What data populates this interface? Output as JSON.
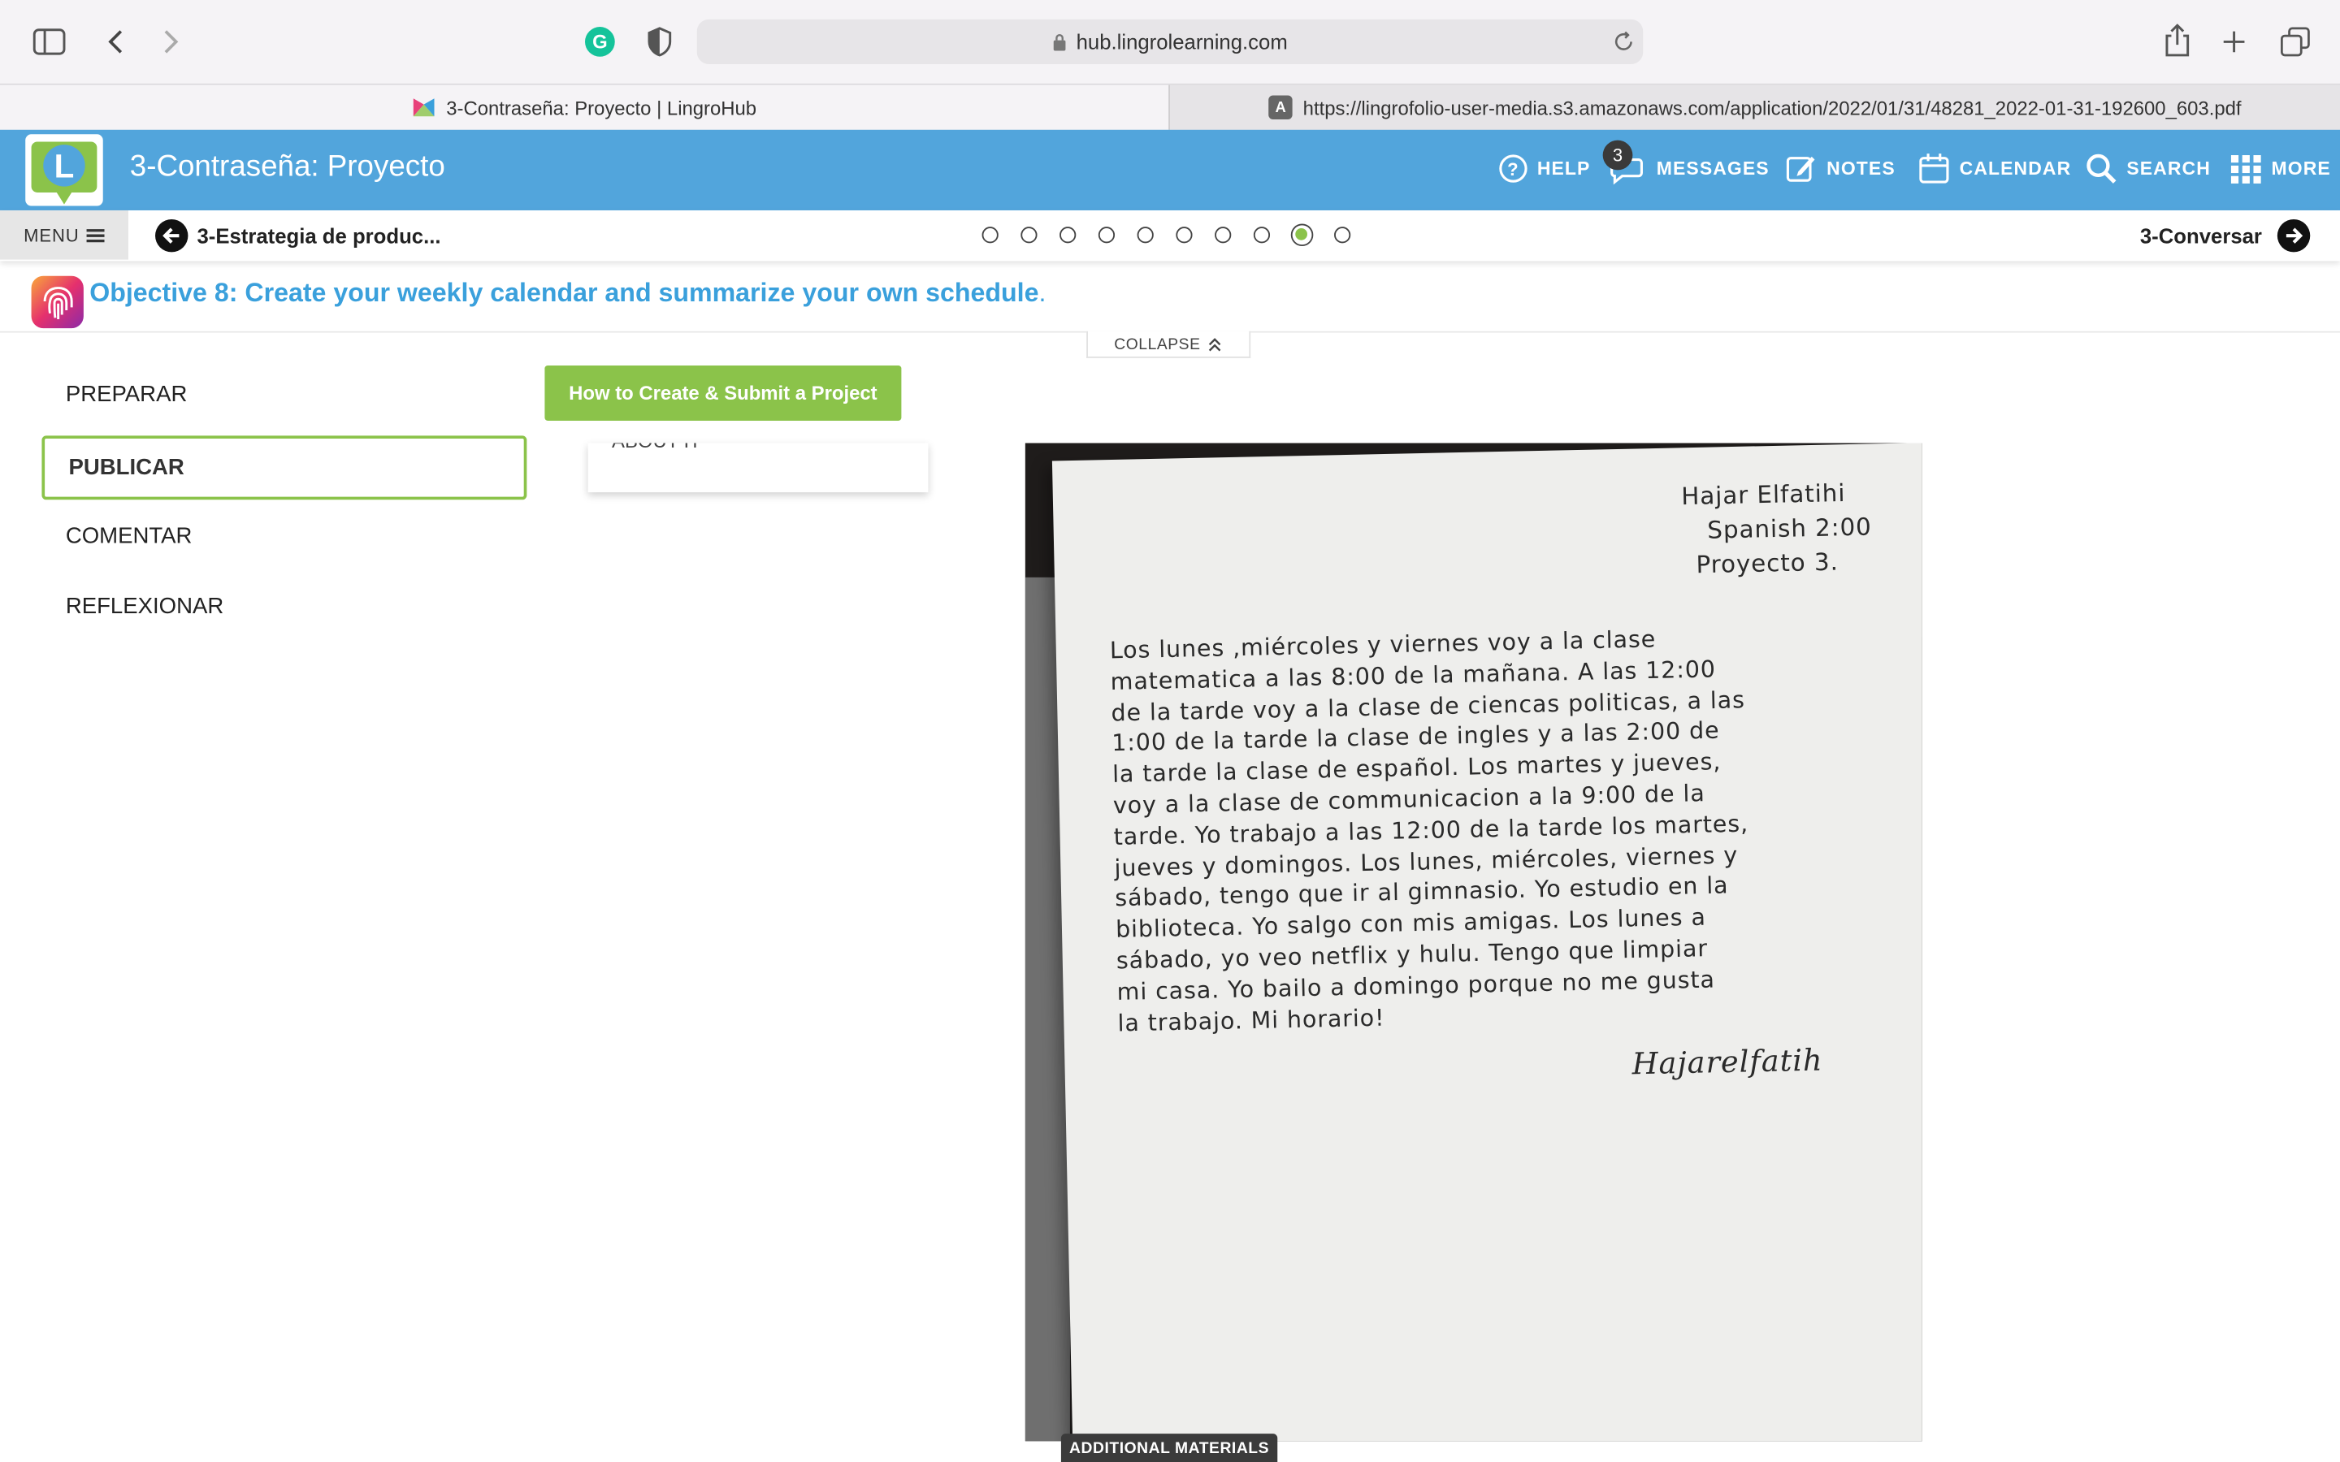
{
  "browser": {
    "url": "hub.lingrolearning.com",
    "tabs": [
      {
        "title": "3-Contraseña: Proyecto | LingroHub"
      },
      {
        "title": "https://lingrofolio-user-media.s3.amazonaws.com/application/2022/01/31/48281_2022-01-31-192600_603.pdf"
      }
    ]
  },
  "app": {
    "title": "3-Contraseña: Proyecto",
    "nav": {
      "help": "HELP",
      "messages": "MESSAGES",
      "messages_count": "3",
      "notes": "NOTES",
      "calendar": "CALENDAR",
      "search": "SEARCH",
      "more": "MORE"
    },
    "brand_color": "#52a5dc",
    "accent_color": "#8bc34a"
  },
  "subnav": {
    "menu_label": "MENU",
    "prev": "3-Estrategia de produc...",
    "next": "3-Conversar",
    "step_count": 10,
    "active_step": 9
  },
  "objective": {
    "text": "Objective 8: Create your weekly calendar and summarize your own schedule",
    "period": "."
  },
  "collapse_label": "COLLAPSE",
  "left_menu": [
    "PREPARAR",
    "PUBLICAR",
    "COMENTAR",
    "REFLEXIONAR"
  ],
  "active_menu": "PUBLICAR",
  "how_button": "How to Create & Submit a Project",
  "card_text": "ABOUT IT",
  "document": {
    "header": [
      "Hajar Elfatihi",
      "Spanish 2:00",
      "Proyecto 3."
    ],
    "lines": [
      "Los lunes ,miércoles y viernes voy a la clase",
      "matematica a las 8:00 de la mañana. A las 12:00",
      "de la tarde voy a la clase de ciencas politicas, a las",
      "1:00 de la tarde la clase de ingles y a las 2:00 de",
      "la tarde la clase de español. Los martes y jueves,",
      "voy a la clase de communicacion a la 9:00 de la",
      "tarde. Yo trabajo a las 12:00 de la tarde los martes,",
      "jueves y domingos. Los lunes, miércoles, viernes y",
      "sábado, tengo que ir al gimnasio. Yo estudio en la",
      "biblioteca. Yo salgo con mis amigas. Los lunes a",
      "sábado, yo veo netflix y hulu. Tengo que limpiar",
      "mi casa. Yo bailo a domingo porque no me gusta",
      "la trabajo. Mi horario!"
    ],
    "signature": "Hajarelfatih"
  },
  "additional_materials": "ADDITIONAL MATERIALS"
}
